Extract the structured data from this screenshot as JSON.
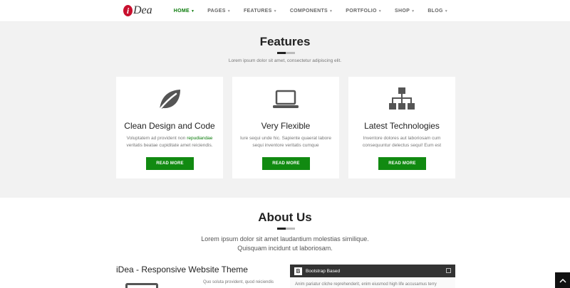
{
  "header": {
    "logo_mark": "i",
    "logo_text": "Dea",
    "nav": [
      {
        "label": "HOME",
        "active": true
      },
      {
        "label": "PAGES",
        "active": false
      },
      {
        "label": "FEATURES",
        "active": false
      },
      {
        "label": "COMPONENTS",
        "active": false
      },
      {
        "label": "PORTFOLIO",
        "active": false
      },
      {
        "label": "SHOP",
        "active": false
      },
      {
        "label": "BLOG",
        "active": false
      }
    ]
  },
  "features": {
    "title": "Features",
    "subtitle": "Lorem ipsum dolor sit amet, consectetur adipiscing elit.",
    "cards": [
      {
        "icon": "leaf-icon",
        "title": "Clean Design and Code",
        "text_before": "Voluptatem ad provident non ",
        "highlight": "repudiandae",
        "text_after": " veritatis beatae cupiditate amet reiciendis.",
        "button": "READ MORE"
      },
      {
        "icon": "laptop-icon",
        "title": "Very Flexible",
        "text_before": "Iure sequi unde hic. Sapiente quaerat labore sequi inventore veritatis cumque",
        "highlight": "",
        "text_after": "",
        "button": "READ MORE"
      },
      {
        "icon": "sitemap-icon",
        "title": "Latest Technologies",
        "text_before": "Inventore dolores aut laboriosam cum consequuntur delectus sequi! Eum est",
        "highlight": "",
        "text_after": "",
        "button": "READ MORE"
      }
    ]
  },
  "about": {
    "title": "About Us",
    "text_line1": "Lorem ipsum dolor sit amet laudantium molestias similique.",
    "text_line2": "Quisquam incidunt ut laboriosam.",
    "theme_title": "iDea - Responsive Website Theme",
    "small_text": "Quo soluta provident, quod reiciendis",
    "panel": {
      "badge": "B",
      "title": "Bootstrap Based",
      "toggle": "⊟",
      "body": "Anim pariatur cliche reprehenderit, enim eiusmod high life accusamus terry"
    }
  },
  "colors": {
    "accent": "#118a11",
    "active_nav": "#0a7a0a",
    "brand": "#c8102e"
  }
}
